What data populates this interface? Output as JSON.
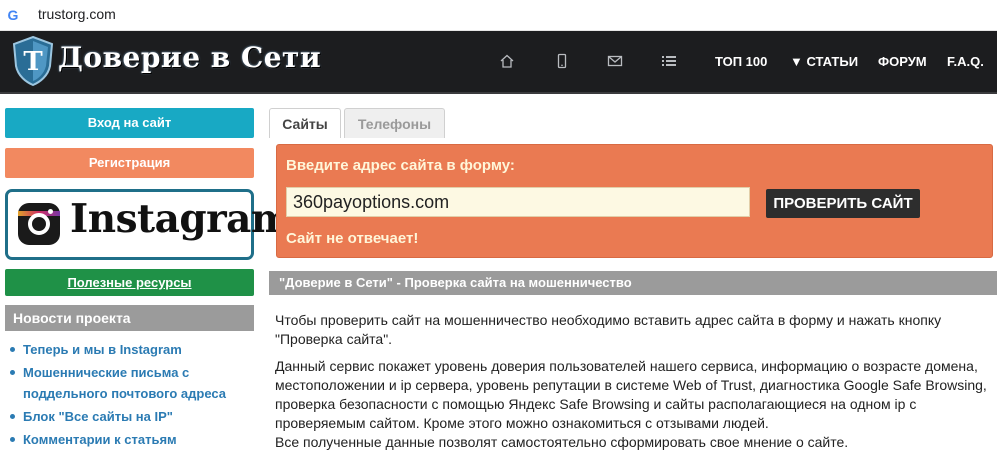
{
  "browser": {
    "url": "trustorg.com"
  },
  "header": {
    "logo_letter": "T",
    "logo_text": "Доверие в Сети",
    "icons": [
      "home-icon",
      "phone-icon",
      "mail-icon",
      "list-icon"
    ],
    "nav": [
      "ТОП 100",
      "▼ СТАТЬИ",
      "ФОРУМ",
      "F.A.Q."
    ]
  },
  "sidebar": {
    "login_label": "Вход на сайт",
    "register_label": "Регистрация",
    "instagram_text": "Instagram",
    "useful_label": "Полезные ресурсы",
    "news_title": "Новости проекта",
    "news": [
      "Теперь и мы в Instagram",
      "Мошеннические письма с поддельного почтового адреса",
      "Блок \"Все сайты на IP\"",
      "Комментарии к статьям"
    ]
  },
  "tabs": [
    "Сайты",
    "Телефоны"
  ],
  "check_form": {
    "title": "Введите адрес сайта в форму:",
    "input_value": "360payoptions.com",
    "button_label": "ПРОВЕРИТЬ САЙТ",
    "status": "Сайт не отвечает!"
  },
  "content": {
    "heading": "\"Доверие в Сети\" - Проверка сайта на мошенничество",
    "paragraph1": "Чтобы проверить сайт на мошенничество необходимо вставить адрес сайта в форму и нажать кнопку \"Проверка сайта\".",
    "paragraph2": "Данный сервис покажет уровень доверия пользователей нашего сервиса, информацию о возрасте домена, местоположении и ip сервера, уровень репутации в системе Web of Trust, диагностика Google Safe Browsing, проверка безопасности с помощью Яндекс Safe Browsing и сайты располагающиеся на одном ip с проверяемым сайтом. Кроме этого можно ознакомиться с отзывами людей.",
    "paragraph3": "Все полученные данные позволят самостоятельно сформировать свое мнение о сайте."
  },
  "colors": {
    "header_bg": "#1c1d1f",
    "login_bg": "#18a9c4",
    "register_bg": "#f28960",
    "useful_bg": "#1f9147",
    "form_bg": "#ea7a52",
    "section_head_bg": "#9b9b9b",
    "link": "#2b7bb3"
  }
}
